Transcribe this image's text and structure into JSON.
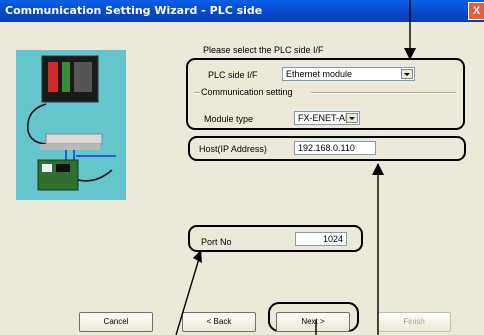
{
  "window": {
    "title": "Communication Setting Wizard - PLC side",
    "close": "X"
  },
  "prompt": "Please select the PLC side I/F",
  "plc_if": {
    "label": "PLC side I/F",
    "value": "Ethernet module"
  },
  "comm_setting": {
    "label": "Communication setting"
  },
  "module_type": {
    "label": "Module type",
    "value": "FX-ENET-ADP"
  },
  "host": {
    "label": "Host(IP Address)",
    "value": "192.168.0.110"
  },
  "port": {
    "label": "Port No",
    "value": "1024"
  },
  "buttons": {
    "cancel": "Cancel",
    "back": "< Back",
    "next": "Next >",
    "finish": "Finish"
  },
  "icons": {
    "close": "close-icon",
    "illustration": "plc-network-illustration"
  }
}
